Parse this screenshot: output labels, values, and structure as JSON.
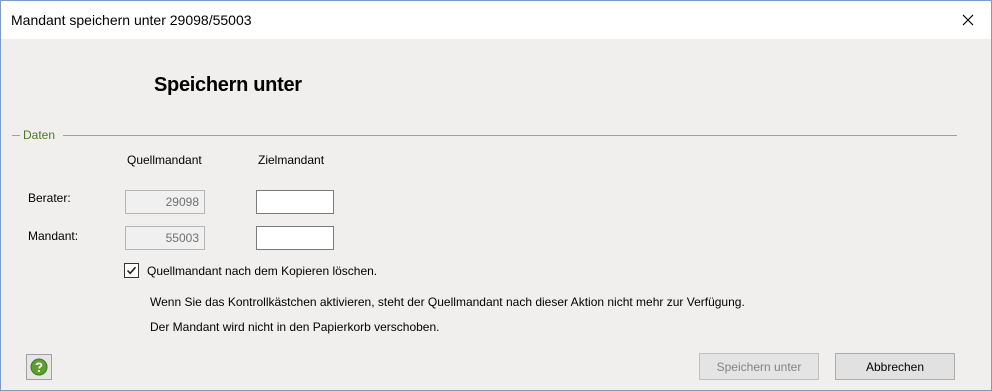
{
  "window": {
    "title": "Mandant speichern unter 29098/55003"
  },
  "heading": "Speichern unter",
  "group": {
    "label": "Daten"
  },
  "columns": {
    "source": "Quellmandant",
    "target": "Zielmandant"
  },
  "rows": {
    "berater": {
      "label": "Berater:",
      "source_value": "29098",
      "target_value": ""
    },
    "mandant": {
      "label": "Mandant:",
      "source_value": "55003",
      "target_value": ""
    }
  },
  "delete_checkbox": {
    "label": "Quellmandant nach dem Kopieren löschen.",
    "checked": true
  },
  "info": {
    "line1": "Wenn Sie das Kontrollkästchen aktivieren, steht der Quellmandant nach dieser Aktion nicht mehr zur Verfügung.",
    "line2": "Der Mandant wird nicht in den Papierkorb verschoben."
  },
  "buttons": {
    "save_as": "Speichern unter",
    "cancel": "Abbrechen"
  },
  "icons": {
    "close": "close-icon",
    "help": "help-icon",
    "check": "checkmark-icon"
  },
  "colors": {
    "group_label": "#4a7a20",
    "help_green": "#5aa02c"
  }
}
